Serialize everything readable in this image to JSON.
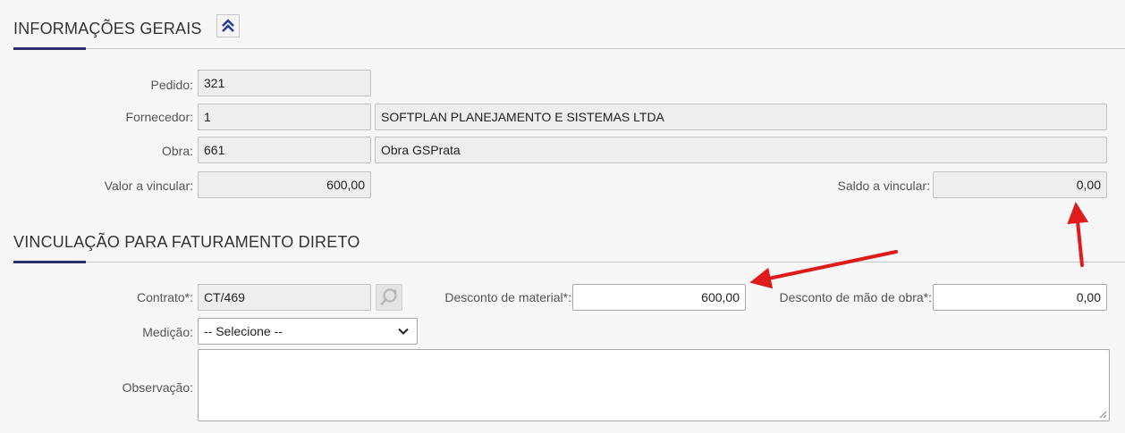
{
  "general": {
    "title": "INFORMAÇÕES GERAIS",
    "pedido_label": "Pedido:",
    "pedido_value": "321",
    "fornecedor_label": "Fornecedor:",
    "fornecedor_code": "1",
    "fornecedor_name": "SOFTPLAN PLANEJAMENTO E SISTEMAS LTDA",
    "obra_label": "Obra:",
    "obra_code": "661",
    "obra_name": "Obra GSPrata",
    "valor_label": "Valor a vincular:",
    "valor_value": "600,00",
    "saldo_label": "Saldo a vincular:",
    "saldo_value": "0,00"
  },
  "vinculacao": {
    "title": "VINCULAÇÃO PARA FATURAMENTO DIRETO",
    "contrato_label": "Contrato*:",
    "contrato_value": "CT/469",
    "desc_material_label": "Desconto de material*:",
    "desc_material_value": "600,00",
    "desc_mao_obra_label": "Desconto de mão de obra*:",
    "desc_mao_obra_value": "0,00",
    "medicao_label": "Medição:",
    "medicao_selected": "-- Selecione --",
    "observacao_label": "Observação:",
    "observacao_value": ""
  },
  "colors": {
    "accent": "#2c2e6e",
    "annotation_arrow": "#e01b1b"
  },
  "icons": [
    "chevrons-up-icon",
    "search-refresh-icon",
    "chevron-down-icon",
    "resize-handle-icon"
  ]
}
